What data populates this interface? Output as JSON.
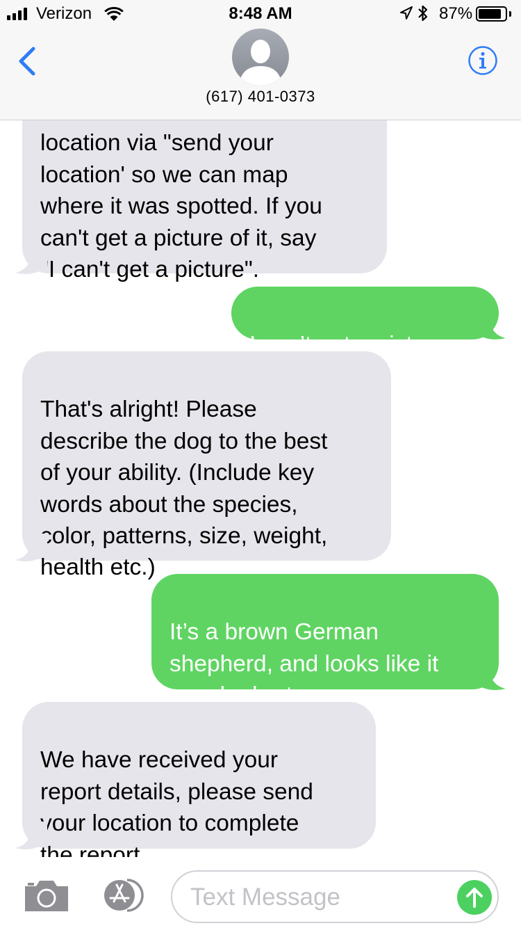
{
  "status_bar": {
    "carrier": "Verizon",
    "time": "8:48 AM",
    "battery_percent": "87%",
    "battery_level": 0.87,
    "icons": [
      "cellular-signal-icon",
      "wifi-icon",
      "location-arrow-icon",
      "bluetooth-icon",
      "battery-icon"
    ]
  },
  "header": {
    "contact_name": "(617) 401-0373",
    "back_icon": "chevron-left-icon",
    "info_icon": "info-icon",
    "avatar_icon": "person-silhouette-icon"
  },
  "messages": [
    {
      "direction": "incoming",
      "text": "location via \"send your\nlocation' so we can map\nwhere it was spotted. If you\ncan't get a picture of it, say\n\"I can't get a picture\"."
    },
    {
      "direction": "outgoing",
      "text": "I can’t get a picture"
    },
    {
      "direction": "incoming",
      "text": "That's alright! Please\ndescribe the dog to the best\nof your ability. (Include key\nwords about the species,\ncolor, patterns, size, weight,\nhealth etc.)"
    },
    {
      "direction": "outgoing",
      "text": "It’s a brown German\nshepherd, and looks like it\nmay be hurt."
    },
    {
      "direction": "incoming",
      "text": "We have received your\nreport details, please send\nyour location to complete\nthe report."
    }
  ],
  "composer": {
    "placeholder": "Text Message",
    "value": "",
    "camera_icon": "camera-icon",
    "apps_icon": "app-store-icon",
    "send_icon": "arrow-up-icon"
  },
  "colors": {
    "accent_blue": "#2f7cf6",
    "incoming_bubble": "#e6e5eb",
    "outgoing_bubble": "#5fd462",
    "send_button": "#4cd160"
  }
}
